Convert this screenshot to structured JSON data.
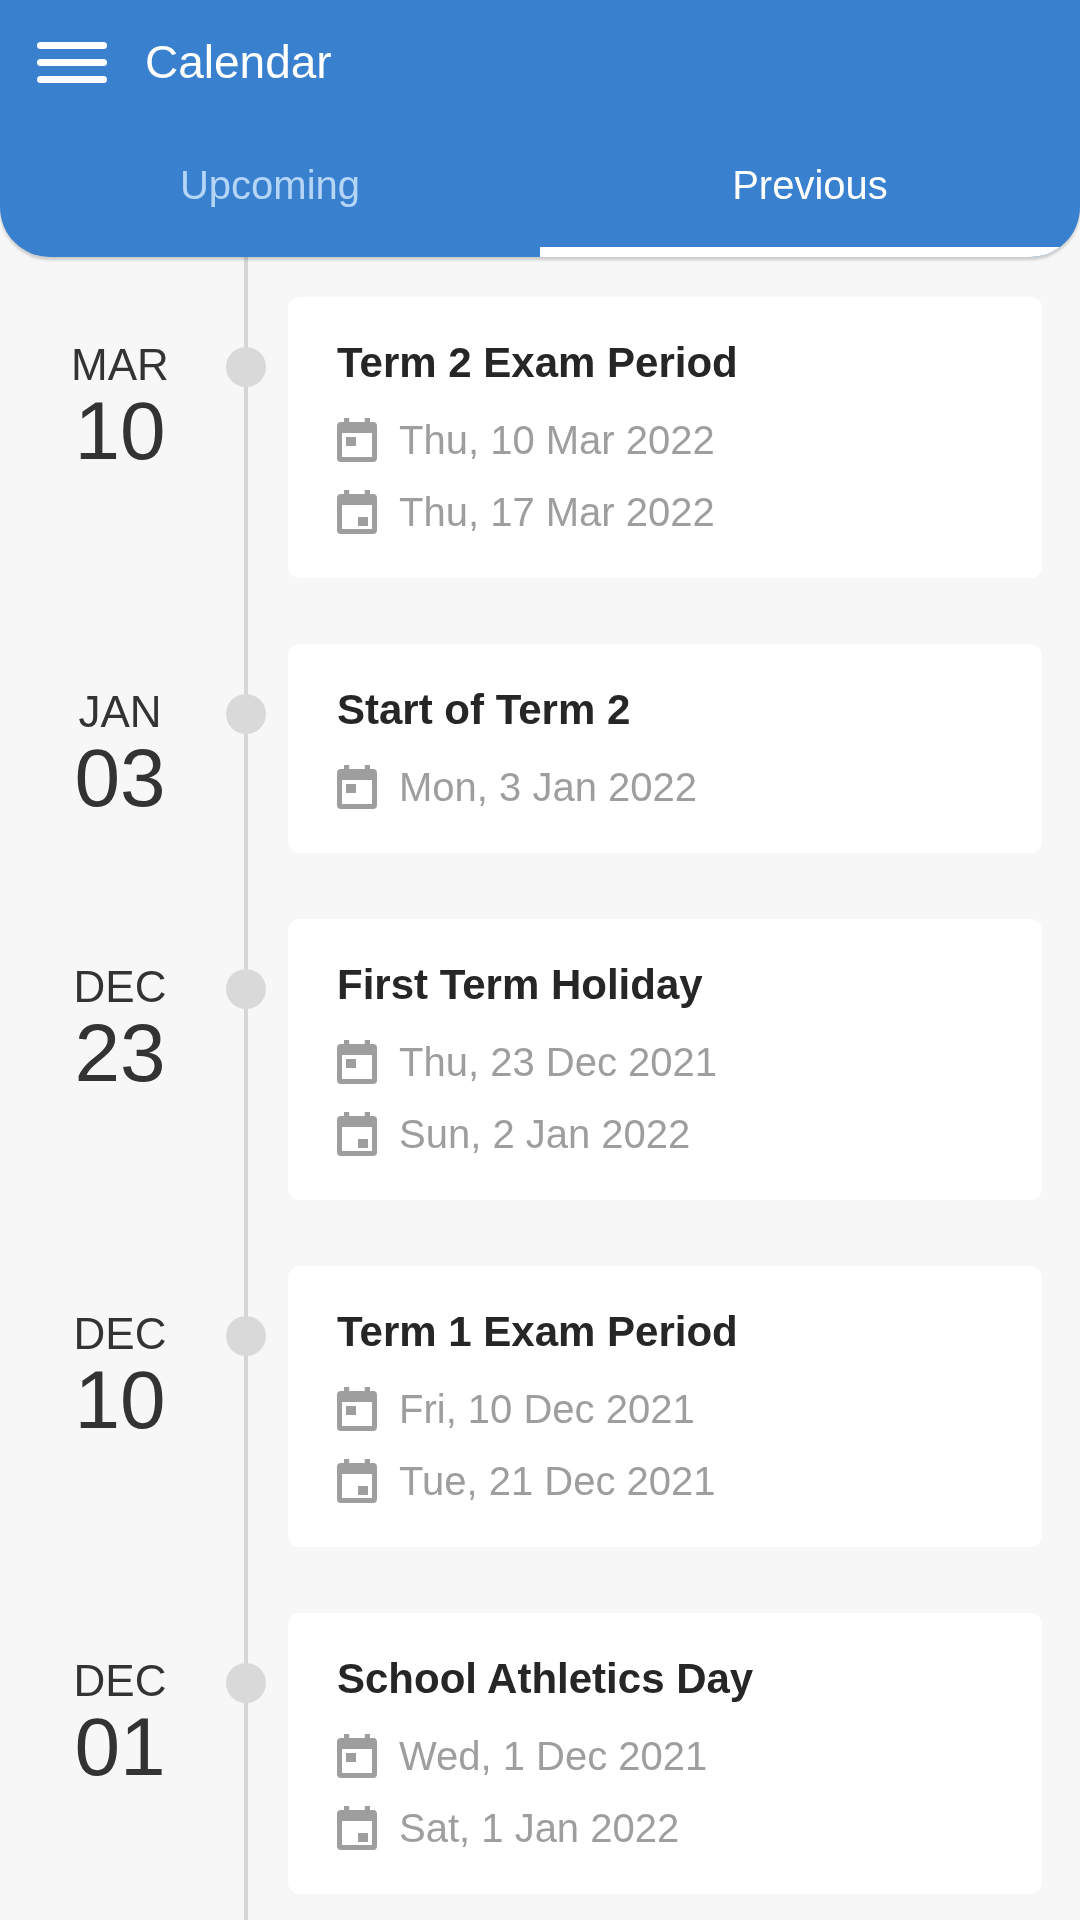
{
  "app_bar": {
    "title": "Calendar"
  },
  "tabs": [
    {
      "label": "Upcoming",
      "selected": false
    },
    {
      "label": "Previous",
      "selected": true
    }
  ],
  "events": [
    {
      "month": "MAR",
      "day": "10",
      "title": "Term 2 Exam Period",
      "dates": [
        {
          "kind": "start",
          "text": "Thu, 10 Mar 2022"
        },
        {
          "kind": "end",
          "text": "Thu, 17 Mar 2022"
        }
      ]
    },
    {
      "month": "JAN",
      "day": "03",
      "title": "Start of Term 2",
      "dates": [
        {
          "kind": "start",
          "text": "Mon, 3 Jan 2022"
        }
      ]
    },
    {
      "month": "DEC",
      "day": "23",
      "title": "First Term Holiday",
      "dates": [
        {
          "kind": "start",
          "text": "Thu, 23 Dec 2021"
        },
        {
          "kind": "end",
          "text": "Sun, 2 Jan 2022"
        }
      ]
    },
    {
      "month": "DEC",
      "day": "10",
      "title": "Term 1 Exam Period",
      "dates": [
        {
          "kind": "start",
          "text": "Fri, 10 Dec 2021"
        },
        {
          "kind": "end",
          "text": "Tue, 21 Dec 2021"
        }
      ]
    },
    {
      "month": "DEC",
      "day": "01",
      "title": "School Athletics Day",
      "dates": [
        {
          "kind": "start",
          "text": "Wed, 1 Dec 2021"
        },
        {
          "kind": "end",
          "text": "Sat, 1 Jan 2022"
        }
      ]
    }
  ]
}
